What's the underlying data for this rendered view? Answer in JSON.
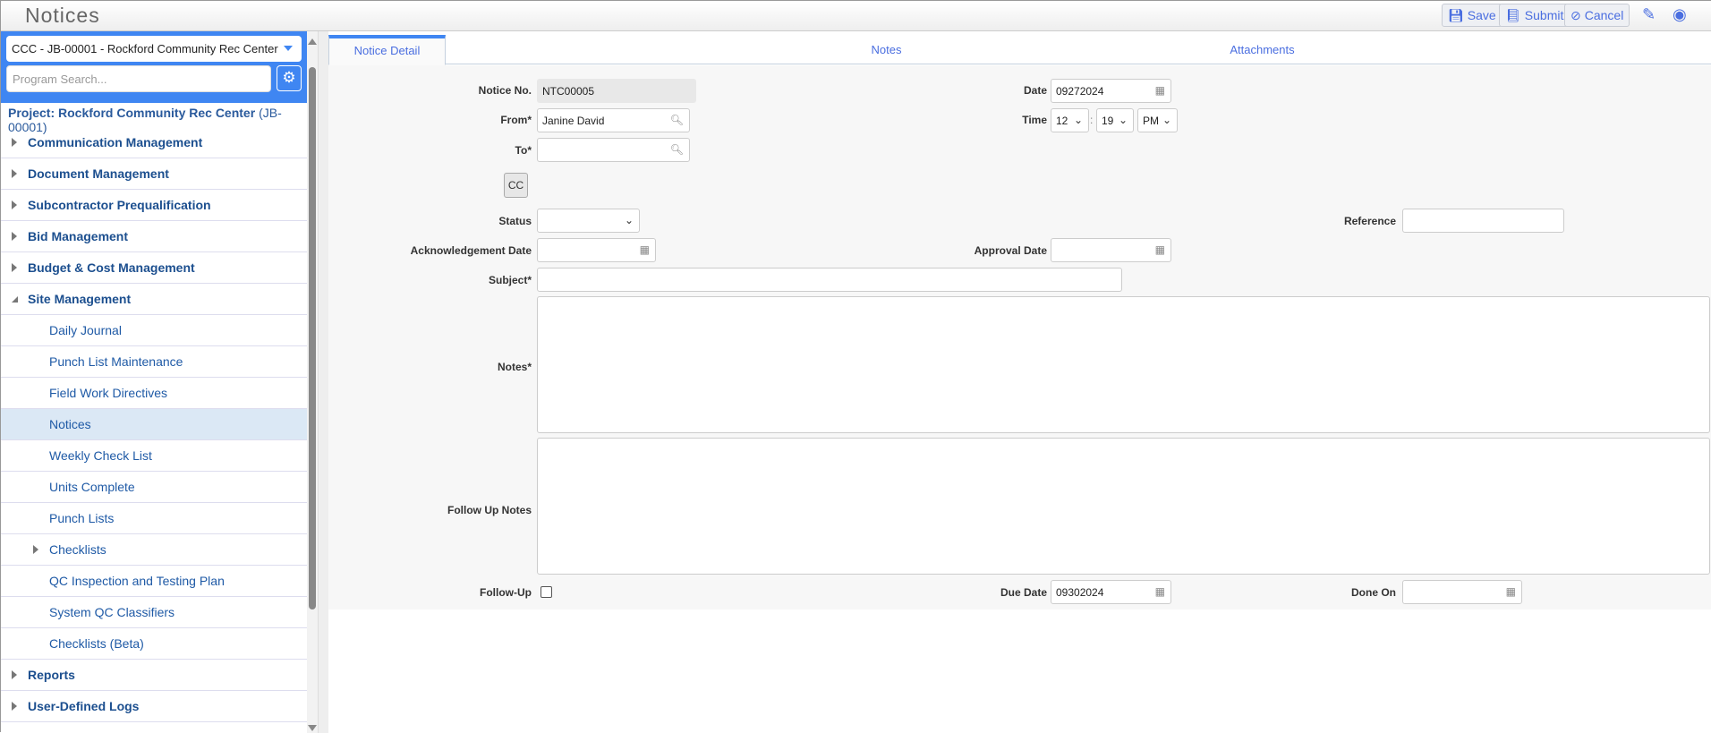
{
  "header": {
    "title": "Notices",
    "save": "Save",
    "submit": "Submit",
    "cancel": "Cancel"
  },
  "sidebar": {
    "project_select": "CCC - JB-00001 - Rockford Community Rec Center",
    "search_placeholder": "Program Search...",
    "project_label": "Project: Rockford Community Rec Center",
    "project_code": "(JB-00001)",
    "items": [
      {
        "label": "Communication Management",
        "level": "top"
      },
      {
        "label": "Document Management",
        "level": "top"
      },
      {
        "label": "Subcontractor Prequalification",
        "level": "top"
      },
      {
        "label": "Bid Management",
        "level": "top"
      },
      {
        "label": "Budget & Cost Management",
        "level": "top"
      },
      {
        "label": "Site Management",
        "level": "top",
        "expanded": true
      },
      {
        "label": "Daily Journal",
        "level": "sub"
      },
      {
        "label": "Punch List Maintenance",
        "level": "sub"
      },
      {
        "label": "Field Work Directives",
        "level": "sub"
      },
      {
        "label": "Notices",
        "level": "sub",
        "selected": true
      },
      {
        "label": "Weekly Check List",
        "level": "sub"
      },
      {
        "label": "Units Complete",
        "level": "sub"
      },
      {
        "label": "Punch Lists",
        "level": "sub"
      },
      {
        "label": "Checklists",
        "level": "sub",
        "collapsible": true
      },
      {
        "label": "QC Inspection and Testing Plan",
        "level": "sub"
      },
      {
        "label": "System QC Classifiers",
        "level": "sub"
      },
      {
        "label": "Checklists (Beta)",
        "level": "sub"
      },
      {
        "label": "Reports",
        "level": "top"
      },
      {
        "label": "User-Defined Logs",
        "level": "top"
      }
    ]
  },
  "tabs": [
    "Notice Detail",
    "Notes",
    "Attachments"
  ],
  "form": {
    "notice_no_label": "Notice No.",
    "notice_no": "NTC00005",
    "from_label": "From*",
    "from": "Janine David",
    "to_label": "To*",
    "to": "",
    "cc": "CC",
    "status_label": "Status",
    "status": "",
    "ack_label": "Acknowledgement Date",
    "ack": "",
    "subject_label": "Subject*",
    "subject": "",
    "notes_label": "Notes*",
    "follow_notes_label": "Follow Up Notes",
    "followup_label": "Follow-Up",
    "followup_checked": false,
    "date_label": "Date",
    "date": "09272024",
    "time_label": "Time",
    "hour": "12",
    "minute": "19",
    "ampm": "PM",
    "colon": ":",
    "reference_label": "Reference",
    "reference": "",
    "approval_label": "Approval Date",
    "approval": "",
    "due_label": "Due Date",
    "due": "09302024",
    "done_label": "Done On",
    "done": ""
  }
}
